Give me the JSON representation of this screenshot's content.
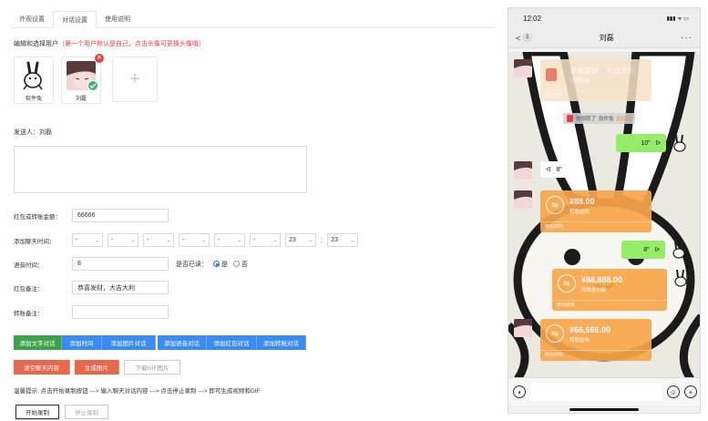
{
  "tabs": [
    {
      "label": "外观设置"
    },
    {
      "label": "对话设置"
    },
    {
      "label": "使用说明"
    }
  ],
  "editor": {
    "hint_prefix": "编辑和选择用户",
    "hint_red": "（第一个用户默认是自己，点击头像可更换头像哦）",
    "users": [
      {
        "name": "软件兔"
      },
      {
        "name": "刘磊"
      }
    ],
    "add_symbol": "+",
    "sender_label": "发送人：",
    "sender_value": "刘磊",
    "fields": {
      "amount_label": "红包或转账金额：",
      "amount_value": "66666",
      "time_label": "添加聊天时间：",
      "time_selects": [
        "-",
        "-",
        "-",
        "-",
        "-",
        "-",
        "23",
        "23"
      ],
      "voice_label": "语音时间：",
      "voice_value": "8",
      "read_label": "是否已读：",
      "read_yes": "是",
      "read_no": "否",
      "rp_note_label": "红包备注：",
      "rp_note_value": "恭喜发财，大吉大利",
      "transfer_note_label": "转账备注：",
      "transfer_note_value": ""
    },
    "buttons": {
      "add_text": "添加文字对话",
      "add_time": "添加时间",
      "add_image": "添加图片对话",
      "add_voice": "添加语音对话",
      "add_redpacket": "添加红包对话",
      "add_transfer": "添加转账对话",
      "clear": "清空聊天内容",
      "generate": "生成图片",
      "download": "下载GIF图片"
    },
    "tip": "温馨提示: 点击开始录制按钮 ---> 输入聊天对话内容 ---> 点击停止录制 ---> 即可生成视频和GIF",
    "record_start": "开始录制",
    "record_stop": "停止录制"
  },
  "phone": {
    "time": "12:02",
    "signal": "▮▮▮ ᯤ ▭",
    "back_count": "1",
    "back_symbol": "<",
    "title": "刘磊",
    "more": "···",
    "redpacket": {
      "title": "恭喜发财，大吉大利",
      "sub": "领取红包",
      "foot": "微信红包"
    },
    "system_msg": {
      "pre": "你领取了",
      "name": "软件兔",
      "post": "的红包"
    },
    "voice_out": "10\"",
    "voice_in": "8\"",
    "transfers": [
      {
        "amount": "¥88.00",
        "sub": "转账给你",
        "foot": "微信转账"
      },
      {
        "amount": "¥88,888.00",
        "sub": "转账给刘磊",
        "foot": "微信转账"
      },
      {
        "amount": "¥66,666.00",
        "sub": "转账给你",
        "foot": "微信转账"
      }
    ],
    "voice_out2": "8\""
  }
}
